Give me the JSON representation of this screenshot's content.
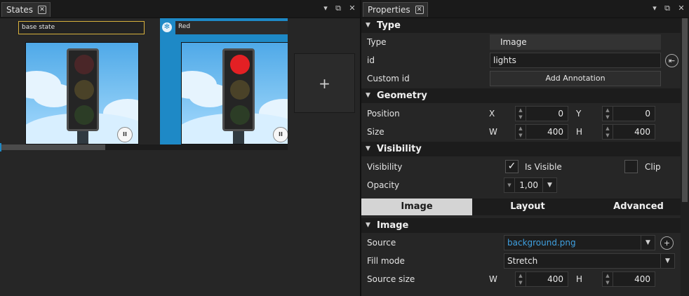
{
  "states_panel": {
    "tab_label": "States",
    "states": [
      {
        "name": "base state"
      },
      {
        "name": "Red"
      }
    ],
    "add_label": "+"
  },
  "properties_panel": {
    "tab_label": "Properties",
    "type_section": {
      "title": "Type",
      "type_label": "Type",
      "type_value": "Image",
      "id_label": "id",
      "id_value": "lights",
      "custom_id_label": "Custom id",
      "add_annotation_label": "Add Annotation"
    },
    "geometry_section": {
      "title": "Geometry",
      "position_label": "Position",
      "x_label": "X",
      "x_value": "0",
      "y_label": "Y",
      "y_value": "0",
      "size_label": "Size",
      "w_label": "W",
      "w_value": "400",
      "h_label": "H",
      "h_value": "400"
    },
    "visibility_section": {
      "title": "Visibility",
      "visibility_label": "Visibility",
      "is_visible_label": "Is Visible",
      "is_visible_checked": true,
      "clip_label": "Clip",
      "clip_checked": false,
      "opacity_label": "Opacity",
      "opacity_value": "1,00"
    },
    "tabs": [
      "Image",
      "Layout",
      "Advanced"
    ],
    "active_tab": "Image",
    "image_section": {
      "title": "Image",
      "source_label": "Source",
      "source_value": "background.png",
      "fill_mode_label": "Fill mode",
      "fill_mode_value": "Stretch",
      "source_size_label": "Source size",
      "w_label": "W",
      "w_value": "400",
      "h_label": "H",
      "h_value": "400"
    }
  },
  "colors": {
    "accent": "#1e89c6",
    "link": "#3fa0e0",
    "red_lamp_on": "#e32024",
    "selection_border": "#d8b13e"
  }
}
